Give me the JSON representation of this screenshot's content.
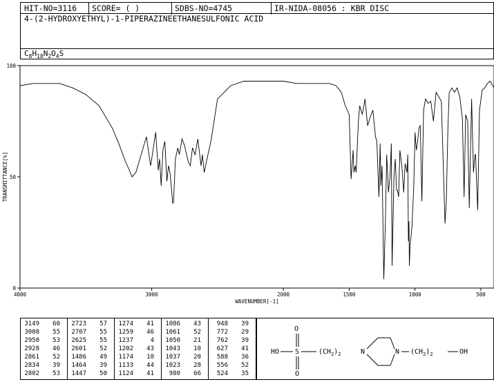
{
  "header": {
    "hit_no": "HIT-NO=3116",
    "score": "SCORE=  (   )",
    "sdbs_no": "SDBS-NO=4745",
    "ir_id": "IR-NIDA-08056 : KBR DISC"
  },
  "compound": {
    "name": "4-(2-HYDROXYETHYL)-1-PIPERAZINEETHANESULFONIC ACID",
    "formula_parts": [
      "C",
      "8",
      "H",
      "18",
      "N",
      "2",
      "O",
      "4",
      "S"
    ]
  },
  "chart_data": {
    "type": "line",
    "title": "",
    "xlabel": "WAVENUMBER[-1]",
    "ylabel": "TRANSMITTANCE[%]",
    "xlim": [
      4000,
      400
    ],
    "ylim": [
      0,
      100
    ],
    "x_ticks": [
      4000,
      3000,
      2000,
      1500,
      1000,
      500
    ],
    "y_ticks": [
      0,
      50,
      100
    ],
    "grid": false,
    "series": [
      {
        "x": [
          4000,
          3900,
          3800,
          3700,
          3600,
          3500,
          3400,
          3300,
          3250,
          3200,
          3170,
          3149,
          3120,
          3080,
          3040,
          3008,
          2990,
          2970,
          2950,
          2940,
          2928,
          2915,
          2900,
          2885,
          2872,
          2861,
          2850,
          2840,
          2834,
          2820,
          2802,
          2790,
          2770,
          2750,
          2723,
          2707,
          2690,
          2670,
          2650,
          2625,
          2615,
          2601,
          2580,
          2550,
          2500,
          2400,
          2300,
          2200,
          2100,
          2000,
          1900,
          1800,
          1700,
          1650,
          1600,
          1560,
          1530,
          1500,
          1486,
          1475,
          1470,
          1464,
          1454,
          1447,
          1430,
          1420,
          1400,
          1380,
          1360,
          1340,
          1320,
          1300,
          1290,
          1274,
          1265,
          1259,
          1250,
          1237,
          1225,
          1215,
          1202,
          1190,
          1180,
          1174,
          1160,
          1150,
          1140,
          1133,
          1124,
          1115,
          1100,
          1086,
          1075,
          1061,
          1055,
          1050,
          1046,
          1043,
          1037,
          1030,
          1023,
          1010,
          1000,
          990,
          980,
          970,
          960,
          948,
          935,
          920,
          900,
          880,
          860,
          840,
          820,
          800,
          785,
          772,
          762,
          750,
          740,
          720,
          700,
          680,
          660,
          640,
          627,
          615,
          600,
          588,
          570,
          556,
          545,
          540,
          524,
          510,
          490,
          470,
          450,
          430,
          400
        ],
        "y": [
          91,
          92,
          92,
          92,
          90,
          87,
          82,
          72,
          65,
          57,
          53,
          50,
          52,
          60,
          68,
          55,
          62,
          70,
          53,
          58,
          46,
          62,
          66,
          48,
          55,
          52,
          45,
          38,
          39,
          58,
          63,
          60,
          67,
          64,
          57,
          55,
          63,
          60,
          67,
          55,
          60,
          52,
          58,
          66,
          85,
          91,
          93,
          93,
          93,
          93,
          92,
          92,
          92,
          92,
          91,
          88,
          82,
          78,
          49,
          58,
          62,
          52,
          55,
          52,
          75,
          82,
          78,
          85,
          73,
          77,
          80,
          68,
          66,
          41,
          65,
          46,
          55,
          4,
          30,
          60,
          43,
          50,
          65,
          10,
          50,
          58,
          44,
          44,
          41,
          62,
          55,
          43,
          56,
          52,
          60,
          21,
          30,
          10,
          20,
          23,
          28,
          45,
          70,
          62,
          66,
          72,
          73,
          39,
          80,
          85,
          83,
          84,
          75,
          88,
          86,
          84,
          55,
          29,
          39,
          72,
          88,
          90,
          88,
          90,
          86,
          76,
          41,
          78,
          75,
          36,
          85,
          52,
          60,
          60,
          35,
          80,
          89,
          90,
          92,
          93,
          90
        ]
      }
    ]
  },
  "peaks": [
    [
      [
        3149,
        60
      ],
      [
        3008,
        55
      ],
      [
        2950,
        53
      ],
      [
        2928,
        46
      ],
      [
        2861,
        52
      ],
      [
        2834,
        39
      ],
      [
        2802,
        53
      ]
    ],
    [
      [
        2723,
        57
      ],
      [
        2707,
        55
      ],
      [
        2625,
        55
      ],
      [
        2601,
        52
      ],
      [
        1486,
        49
      ],
      [
        1464,
        39
      ],
      [
        1447,
        50
      ]
    ],
    [
      [
        1274,
        41
      ],
      [
        1259,
        46
      ],
      [
        1237,
        4
      ],
      [
        1202,
        43
      ],
      [
        1174,
        10
      ],
      [
        1133,
        44
      ],
      [
        1124,
        41
      ]
    ],
    [
      [
        1086,
        43
      ],
      [
        1061,
        52
      ],
      [
        1050,
        21
      ],
      [
        1043,
        10
      ],
      [
        1037,
        20
      ],
      [
        1023,
        28
      ],
      [
        980,
        66
      ]
    ],
    [
      [
        948,
        39
      ],
      [
        772,
        29
      ],
      [
        762,
        39
      ],
      [
        627,
        41
      ],
      [
        588,
        36
      ],
      [
        556,
        52
      ],
      [
        524,
        35
      ]
    ]
  ],
  "structure": {
    "labels": [
      "O",
      "O",
      "HO",
      "S",
      "(CH",
      "2",
      ")",
      "2",
      "N",
      "N",
      "(CH",
      "2",
      ")",
      "2",
      "OH"
    ]
  }
}
